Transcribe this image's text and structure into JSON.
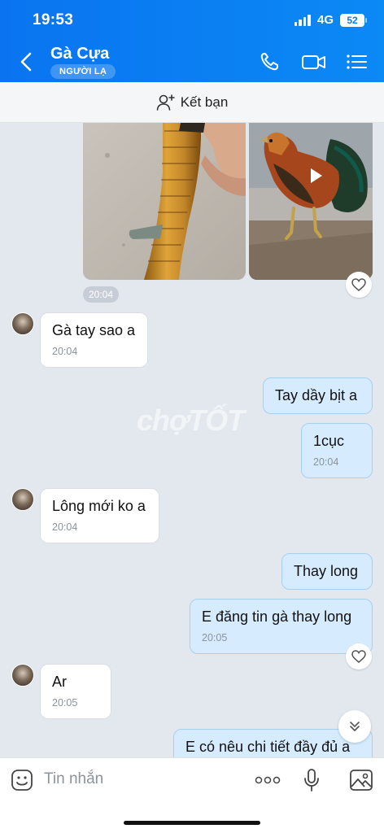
{
  "status": {
    "time": "19:53",
    "network": "4G",
    "battery": "52"
  },
  "header": {
    "title": "Gà Cựa",
    "badge": "NGƯỜI LẠ"
  },
  "friend_bar": {
    "label": "Kết bạn"
  },
  "media_time": "20:04",
  "messages": [
    {
      "text": "Gà tay sao a",
      "time": "20:04"
    },
    {
      "text": "Tay dầy bịt a",
      "time": ""
    },
    {
      "text": "1cục",
      "time": "20:04"
    },
    {
      "text": "Lông mới ko a",
      "time": "20:04"
    },
    {
      "text": "Thay long",
      "time": ""
    },
    {
      "text": "E đăng tin gà thay long",
      "time": "20:05"
    },
    {
      "text": "Ar",
      "time": "20:05"
    },
    {
      "text": "E có nêu chi tiết đầy đủ a",
      "time": ""
    }
  ],
  "watermark": "chợTỐT",
  "input": {
    "placeholder": "Tin nhắn"
  },
  "colors": {
    "header": "#0a7df2",
    "bubble_out": "#d6ecfe",
    "bubble_in": "#ffffff",
    "background": "#e3e8ef"
  }
}
